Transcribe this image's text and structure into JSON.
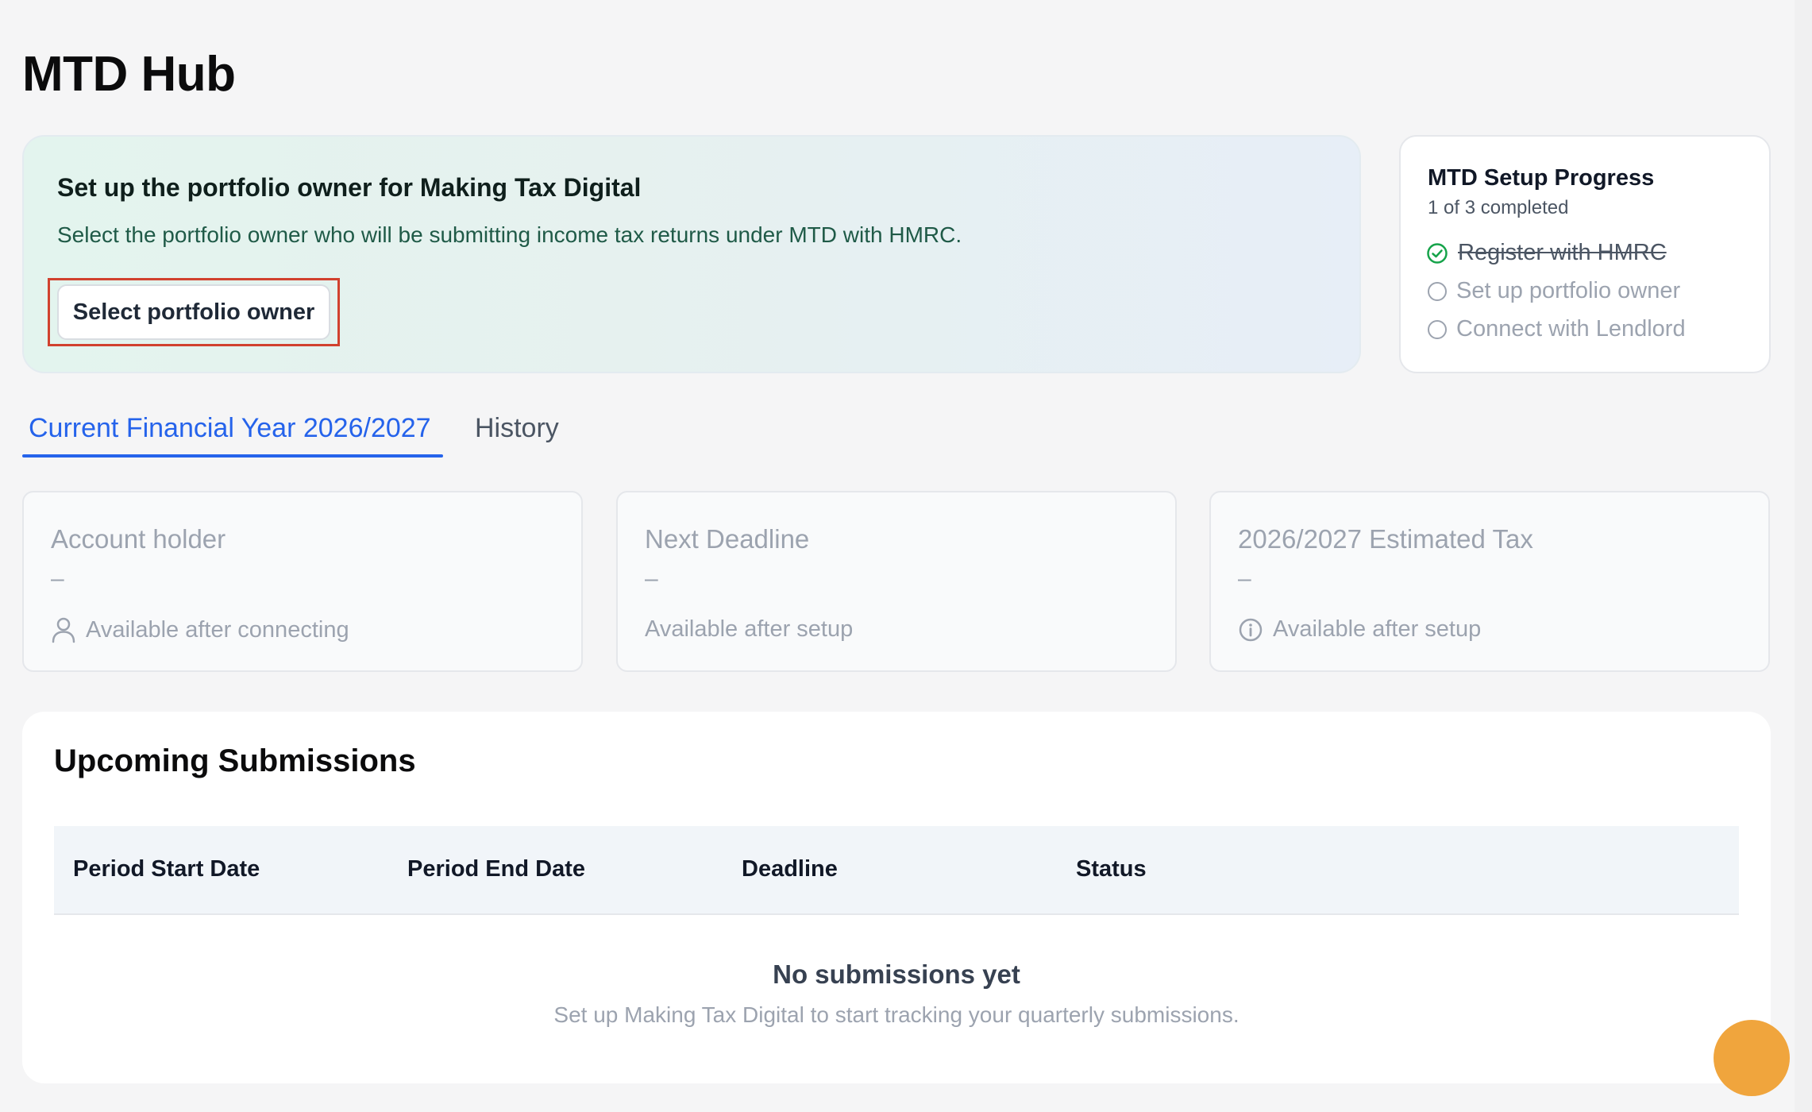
{
  "page": {
    "title": "MTD Hub"
  },
  "banner": {
    "title": "Set up the portfolio owner for Making Tax Digital",
    "description": "Select the portfolio owner who will be submitting income tax returns under MTD with HMRC.",
    "button_label": "Select portfolio owner"
  },
  "progress": {
    "title": "MTD Setup Progress",
    "count": "1 of 3 completed",
    "steps": [
      {
        "label": "Register with HMRC",
        "done": true
      },
      {
        "label": "Set up portfolio owner",
        "done": false
      },
      {
        "label": "Connect with Lendlord",
        "done": false
      }
    ]
  },
  "tabs": [
    {
      "label": "Current Financial Year 2026/2027",
      "active": true
    },
    {
      "label": "History",
      "active": false
    }
  ],
  "cards": [
    {
      "label": "Account holder",
      "value": "–",
      "note": "Available after connecting",
      "icon": "user-icon"
    },
    {
      "label": "Next Deadline",
      "value": "–",
      "note": "Available after setup",
      "icon": ""
    },
    {
      "label": "2026/2027 Estimated Tax",
      "value": "–",
      "note": "Available after setup",
      "icon": "info-icon"
    }
  ],
  "submissions": {
    "title": "Upcoming Submissions",
    "columns": [
      "Period Start Date",
      "Period End Date",
      "Deadline",
      "Status"
    ],
    "empty_title": "No submissions yet",
    "empty_description": "Set up Making Tax Digital to start tracking your quarterly submissions."
  },
  "colors": {
    "accent": "#2563eb",
    "success": "#16a34a",
    "highlight": "#d1412e",
    "fab": "#f0a53d"
  }
}
